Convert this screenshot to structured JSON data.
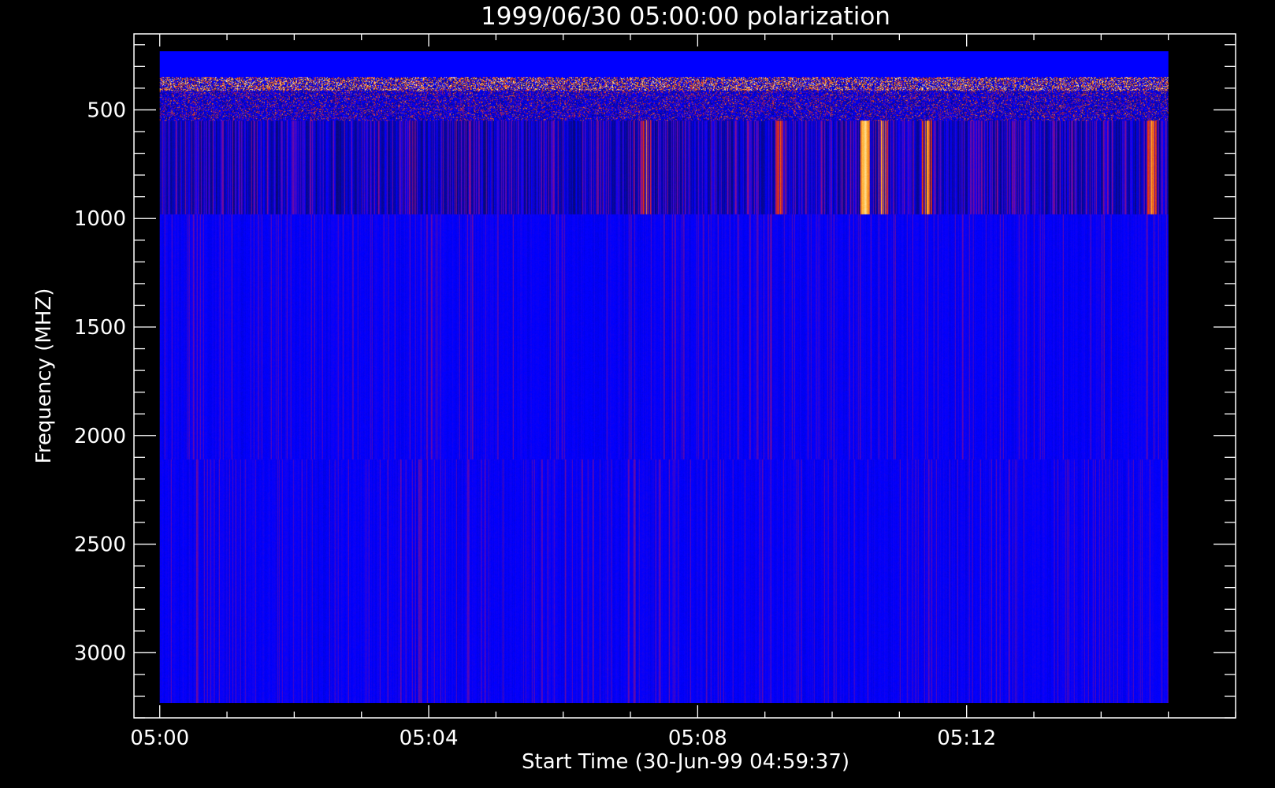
{
  "chart_data": {
    "type": "heatmap",
    "title": "1999/06/30 05:00:00 polarization",
    "xlabel": "Start Time (30-Jun-99 04:59:37)",
    "ylabel": "Frequency (MHZ)",
    "x_range": [
      "04:59:37",
      "05:16:00"
    ],
    "x_data_range": [
      "05:00:00",
      "05:15:00"
    ],
    "x_major_ticks": [
      "05:00",
      "05:04",
      "05:08",
      "05:12"
    ],
    "x_minor_tick_interval_min": 1,
    "y_range_mhz": [
      3300,
      150
    ],
    "y_axis_inverted": true,
    "y_data_range_mhz": [
      230,
      3230
    ],
    "y_major_ticks": [
      500,
      1000,
      1500,
      2000,
      2500,
      3000
    ],
    "y_minor_tick_interval_mhz": 100,
    "colormap": [
      "#0a0a64",
      "#0000ff",
      "#8a0d8a",
      "#e03010",
      "#ffb030",
      "#ffffe0"
    ],
    "bands": [
      {
        "name": "band-saturated",
        "f_start": 230,
        "f_end": 350,
        "texture": "flat",
        "seed": 1
      },
      {
        "name": "band-speckle",
        "f_start": 350,
        "f_end": 410,
        "texture": "speckle",
        "seed": 2
      },
      {
        "name": "band-mixed",
        "f_start": 410,
        "f_end": 550,
        "texture": "mixed",
        "seed": 3
      },
      {
        "name": "band-striped",
        "f_start": 550,
        "f_end": 980,
        "texture": "striped",
        "seed": 4
      },
      {
        "name": "band-uniform-1",
        "f_start": 980,
        "f_end": 2110,
        "texture": "fine",
        "seed": 5
      },
      {
        "name": "band-uniform-2",
        "f_start": 2110,
        "f_end": 3230,
        "texture": "fine",
        "seed": 6
      }
    ],
    "bright_events": [
      {
        "time": "05:07:14",
        "band": "band-striped",
        "level": 0.75
      },
      {
        "time": "05:09:14",
        "band": "band-striped",
        "level": 0.7
      },
      {
        "time": "05:10:30",
        "band": "band-striped",
        "level": 0.95
      },
      {
        "time": "05:10:45",
        "band": "band-striped",
        "level": 0.85
      },
      {
        "time": "05:11:25",
        "band": "band-striped",
        "level": 0.85
      },
      {
        "time": "05:14:45",
        "band": "band-striped",
        "level": 0.8
      }
    ]
  }
}
